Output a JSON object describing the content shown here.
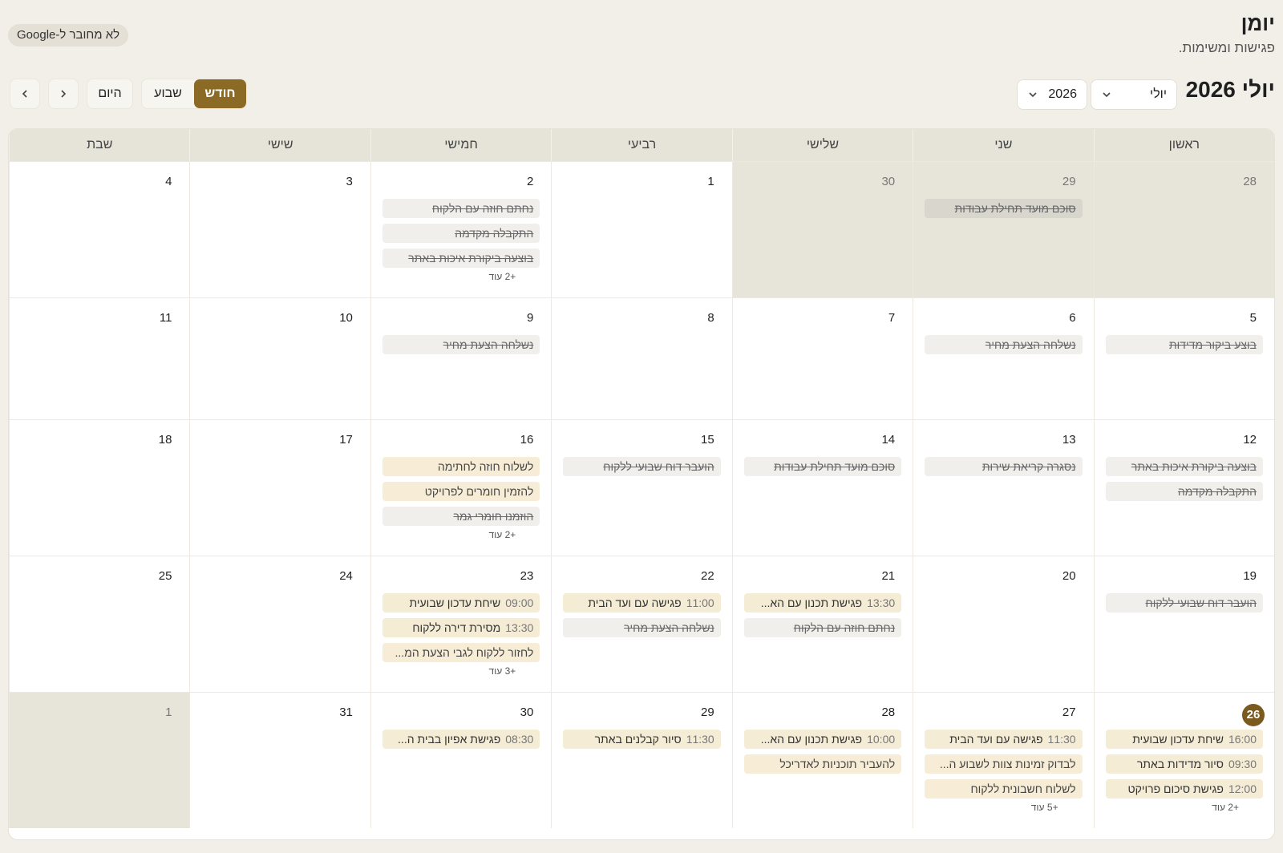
{
  "app": {
    "title": "יומן",
    "subtitle": "פגישות ומשימות."
  },
  "google_badge": "לא מחובר ל-Google",
  "toolbar": {
    "month_label": "יולי 2026",
    "month_select": "יולי",
    "year_select": "2026",
    "views": [
      "חודש",
      "שבוע"
    ],
    "active_view": "חודש",
    "today": "היום"
  },
  "weekdays": [
    "ראשון",
    "שני",
    "שלישי",
    "רביעי",
    "חמישי",
    "שישי",
    "שבת"
  ],
  "weeks": [
    {
      "days": [
        {
          "num": "28",
          "other": true,
          "events": []
        },
        {
          "num": "29",
          "other": true,
          "events": [
            {
              "kind": "done",
              "text": "סוכם מועד תחילת עבודות"
            }
          ]
        },
        {
          "num": "30",
          "other": true,
          "events": []
        },
        {
          "num": "1",
          "events": []
        },
        {
          "num": "2",
          "events": [
            {
              "kind": "done",
              "text": "נחתם חוזה עם הלקוח"
            },
            {
              "kind": "done",
              "text": "התקבלה מקדמה"
            },
            {
              "kind": "done",
              "text": "בוצעה ביקורת איכות באתר"
            }
          ],
          "more": "+2 עוד"
        },
        {
          "num": "3",
          "events": []
        },
        {
          "num": "4",
          "events": []
        }
      ]
    },
    {
      "days": [
        {
          "num": "5",
          "events": [
            {
              "kind": "done",
              "text": "בוצע ביקור מדידות"
            }
          ]
        },
        {
          "num": "6",
          "events": [
            {
              "kind": "done",
              "text": "נשלחה הצעת מחיר"
            }
          ]
        },
        {
          "num": "7",
          "events": []
        },
        {
          "num": "8",
          "events": []
        },
        {
          "num": "9",
          "events": [
            {
              "kind": "done",
              "text": "נשלחה הצעת מחיר"
            }
          ]
        },
        {
          "num": "10",
          "events": []
        },
        {
          "num": "11",
          "events": []
        }
      ]
    },
    {
      "days": [
        {
          "num": "12",
          "events": [
            {
              "kind": "done",
              "text": "בוצעה ביקורת איכות באתר"
            },
            {
              "kind": "done",
              "text": "התקבלה מקדמה"
            }
          ]
        },
        {
          "num": "13",
          "events": [
            {
              "kind": "done",
              "text": "נסגרה קריאת שירות"
            }
          ]
        },
        {
          "num": "14",
          "events": [
            {
              "kind": "done",
              "text": "סוכם מועד תחילת עבודות"
            }
          ]
        },
        {
          "num": "15",
          "events": [
            {
              "kind": "done",
              "text": "הועבר דוח שבועי ללקוח"
            }
          ]
        },
        {
          "num": "16",
          "events": [
            {
              "kind": "todo",
              "text": "לשלוח חוזה לחתימה"
            },
            {
              "kind": "todo",
              "text": "להזמין חומרים לפרויקט"
            },
            {
              "kind": "done",
              "text": "הוזמנו חומרי גמר"
            }
          ],
          "more": "+2 עוד"
        },
        {
          "num": "17",
          "events": []
        },
        {
          "num": "18",
          "events": []
        }
      ]
    },
    {
      "days": [
        {
          "num": "19",
          "events": [
            {
              "kind": "done",
              "text": "הועבר דוח שבועי ללקוח"
            }
          ]
        },
        {
          "num": "20",
          "events": []
        },
        {
          "num": "21",
          "events": [
            {
              "kind": "appt",
              "time": "13:30",
              "text": "פגישת תכנון עם הא..."
            },
            {
              "kind": "done",
              "text": "נחתם חוזה עם הלקוח"
            }
          ]
        },
        {
          "num": "22",
          "events": [
            {
              "kind": "appt",
              "time": "11:00",
              "text": "פגישה עם ועד הבית"
            },
            {
              "kind": "done",
              "text": "נשלחה הצעת מחיר"
            }
          ]
        },
        {
          "num": "23",
          "events": [
            {
              "kind": "appt",
              "time": "09:00",
              "text": "שיחת עדכון שבועית"
            },
            {
              "kind": "appt",
              "time": "13:30",
              "text": "מסירת דירה ללקוח"
            },
            {
              "kind": "todo",
              "text": "לחזור ללקוח לגבי הצעת המ..."
            }
          ],
          "more": "+3 עוד"
        },
        {
          "num": "24",
          "events": []
        },
        {
          "num": "25",
          "events": []
        }
      ]
    },
    {
      "days": [
        {
          "num": "26",
          "today": true,
          "events": [
            {
              "kind": "appt",
              "time": "16:00",
              "text": "שיחת עדכון שבועית"
            },
            {
              "kind": "appt",
              "time": "09:30",
              "text": "סיור מדידות באתר"
            },
            {
              "kind": "appt",
              "time": "12:00",
              "text": "פגישת סיכום פרויקט"
            }
          ],
          "more": "+2 עוד"
        },
        {
          "num": "27",
          "events": [
            {
              "kind": "appt",
              "time": "11:30",
              "text": "פגישה עם ועד הבית"
            },
            {
              "kind": "todo",
              "text": "לבדוק זמינות צוות לשבוע ה..."
            },
            {
              "kind": "todo",
              "text": "לשלוח חשבונית ללקוח"
            }
          ],
          "more": "+5 עוד"
        },
        {
          "num": "28",
          "events": [
            {
              "kind": "appt",
              "time": "10:00",
              "text": "פגישת תכנון עם הא..."
            },
            {
              "kind": "todo",
              "text": "להעביר תוכניות לאדריכל"
            }
          ]
        },
        {
          "num": "29",
          "events": [
            {
              "kind": "appt",
              "time": "11:30",
              "text": "סיור קבלנים באתר"
            }
          ]
        },
        {
          "num": "30",
          "events": [
            {
              "kind": "appt",
              "time": "08:30",
              "text": "פגישת אפיון בבית ה..."
            }
          ]
        },
        {
          "num": "31",
          "events": []
        },
        {
          "num": "1",
          "other": true,
          "events": []
        }
      ]
    }
  ]
}
